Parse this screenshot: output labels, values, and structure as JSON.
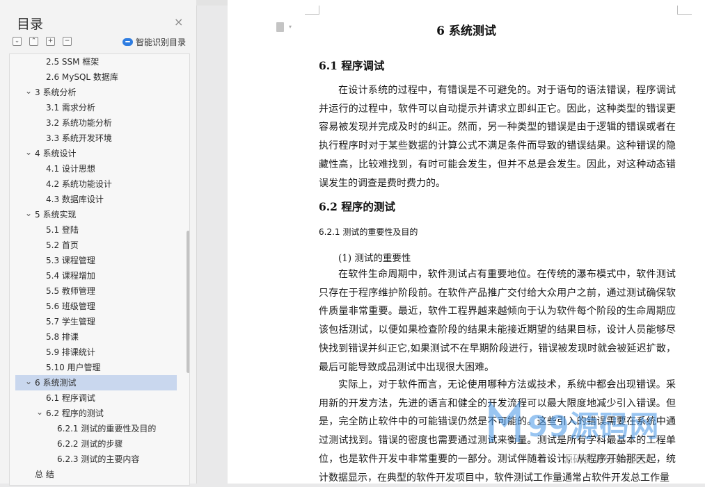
{
  "toc": {
    "title": "目录",
    "close": "×",
    "tools": [
      "⌄",
      "⌃",
      "+",
      "−"
    ],
    "smart_label": "智能识别目录",
    "items": [
      {
        "label": "2.5 SSM 框架",
        "level": 2
      },
      {
        "label": "2.6 MySQL 数据库",
        "level": 2
      },
      {
        "label": "3 系统分析",
        "level": 1,
        "expanded": true
      },
      {
        "label": "3.1 需求分析",
        "level": 2
      },
      {
        "label": "3.2 系统功能分析",
        "level": 2
      },
      {
        "label": "3.3 系统开发环境",
        "level": 2
      },
      {
        "label": "4 系统设计",
        "level": 1,
        "expanded": true
      },
      {
        "label": "4.1 设计思想",
        "level": 2
      },
      {
        "label": "4.2 系统功能设计",
        "level": 2
      },
      {
        "label": "4.3 数据库设计",
        "level": 2
      },
      {
        "label": "5 系统实现",
        "level": 1,
        "expanded": true
      },
      {
        "label": "5.1 登陆",
        "level": 2
      },
      {
        "label": "5.2 首页",
        "level": 2
      },
      {
        "label": "5.3 课程管理",
        "level": 2
      },
      {
        "label": "5.4 课程增加",
        "level": 2
      },
      {
        "label": "5.5 教师管理",
        "level": 2
      },
      {
        "label": "5.6 班级管理",
        "level": 2
      },
      {
        "label": "5.7 学生管理",
        "level": 2
      },
      {
        "label": "5.8 排课",
        "level": 2
      },
      {
        "label": "5.9 排课统计",
        "level": 2
      },
      {
        "label": "5.10 用户管理",
        "level": 2
      },
      {
        "label": "6 系统测试",
        "level": 1,
        "expanded": true,
        "selected": true
      },
      {
        "label": "6.1  程序调试",
        "level": 2
      },
      {
        "label": "6.2  程序的测试",
        "level": 2,
        "expanded": true
      },
      {
        "label": "6.2.1  测试的重要性及目的",
        "level": 3
      },
      {
        "label": "6.2.2  测试的步骤",
        "level": 3
      },
      {
        "label": "6.2.3  测试的主要内容",
        "level": 3
      },
      {
        "label": "总  结",
        "level": 1
      }
    ]
  },
  "doc": {
    "chapter_title": "6 系统测试",
    "s61_heading": "6.1  程序调试",
    "s61_para": "在设计系统的过程中，有错误是不可避免的。对于语句的语法错误，程序调试并运行的过程中，软件可以自动提示并请求立即纠正它。因此，这种类型的错误更容易被发现并完成及时的纠正。然而，另一种类型的错误是由于逻辑的错误或者在执行程序时对于某些数据的计算公式不满足条件而导致的错误结果。这种错误的隐藏性高，比较难找到，有时可能会发生，但并不总是会发生。因此，对这种动态错误发生的调查是费时费力的。",
    "s62_heading": "6.2  程序的测试",
    "s621_heading": "6.2.1  测试的重要性及目的",
    "s621_sub": "(1)  测试的重要性",
    "s621_para1": "在软件生命周期中，软件测试占有重要地位。在传统的瀑布模式中，软件测试只存在于程序维护阶段前。在软件产品推广交付给大众用户之前，通过测试确保软件质量非常重要。最近，软件工程界越来越倾向于认为软件每个阶段的生命周期应该包括测试，以便如果检查阶段的结果未能接近期望的结果目标，设计人员能够尽快找到错误并纠正它,如果测试不在早期阶段进行，错误被发现时就会被延迟扩散，最后可能导致成品测试中出现很大困难。",
    "s621_para2": "实际上，对于软件而言，无论使用哪种方法或技术，系统中都会出现错误。采用新的开发方法，先进的语言和健全的开发流程可以最大限度地减少引入错误。但是，完全防止软件中的可能错误仍然是不可能的。这些引入的错误需要在系统中通过测试找到。错误的密度也需要通过测试来衡量。测试是所有学科最基本的工程单位，也是软件开发中非常重要的一部分。测试伴随着设计，从程序开始那天起，统计数据显示，在典型的软件开发项目中，软件测试工作量通常占软件开发总工作量"
  },
  "watermark": {
    "main": "99源码网",
    "sub": "源码资源分享社区"
  }
}
